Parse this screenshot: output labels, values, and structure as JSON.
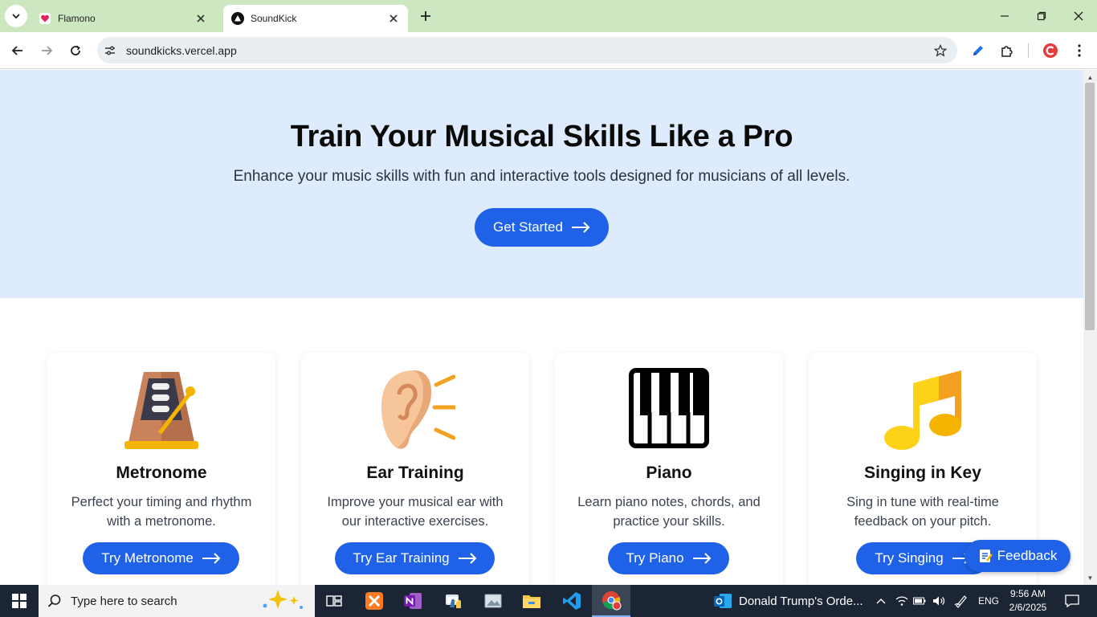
{
  "browser": {
    "tabs": [
      {
        "title": "Flamono",
        "active": false
      },
      {
        "title": "SoundKick",
        "active": true
      }
    ],
    "url": "soundkicks.vercel.app"
  },
  "hero": {
    "title": "Train Your Musical Skills Like a Pro",
    "subtitle": "Enhance your music skills with fun and interactive tools designed for musicians of all levels.",
    "cta_label": "Get Started"
  },
  "cards": [
    {
      "title": "Metronome",
      "desc_line1": "Perfect your timing and rhythm",
      "desc_line2": "with a metronome.",
      "button": "Try Metronome",
      "icon": "metronome-icon"
    },
    {
      "title": "Ear Training",
      "desc_line1": "Improve your musical ear with",
      "desc_line2": "our interactive exercises.",
      "button": "Try Ear Training",
      "icon": "ear-icon"
    },
    {
      "title": "Piano",
      "desc_line1": "Learn piano notes, chords, and",
      "desc_line2": "practice your skills.",
      "button": "Try Piano",
      "icon": "piano-icon"
    },
    {
      "title": "Singing in Key",
      "desc_line1": "Sing in tune with real-time",
      "desc_line2": "feedback on your pitch.",
      "button": "Try Singing",
      "icon": "music-notes-icon"
    }
  ],
  "feedback_label": "Feedback",
  "taskbar": {
    "search_placeholder": "Type here to search",
    "news": "Donald Trump's Orde...",
    "language": "ENG",
    "time": "9:56 AM",
    "date": "2/6/2025"
  },
  "colors": {
    "accent": "#1f62e8",
    "hero_bg": "#deebfc",
    "tabbar_bg": "#cde8c0"
  }
}
